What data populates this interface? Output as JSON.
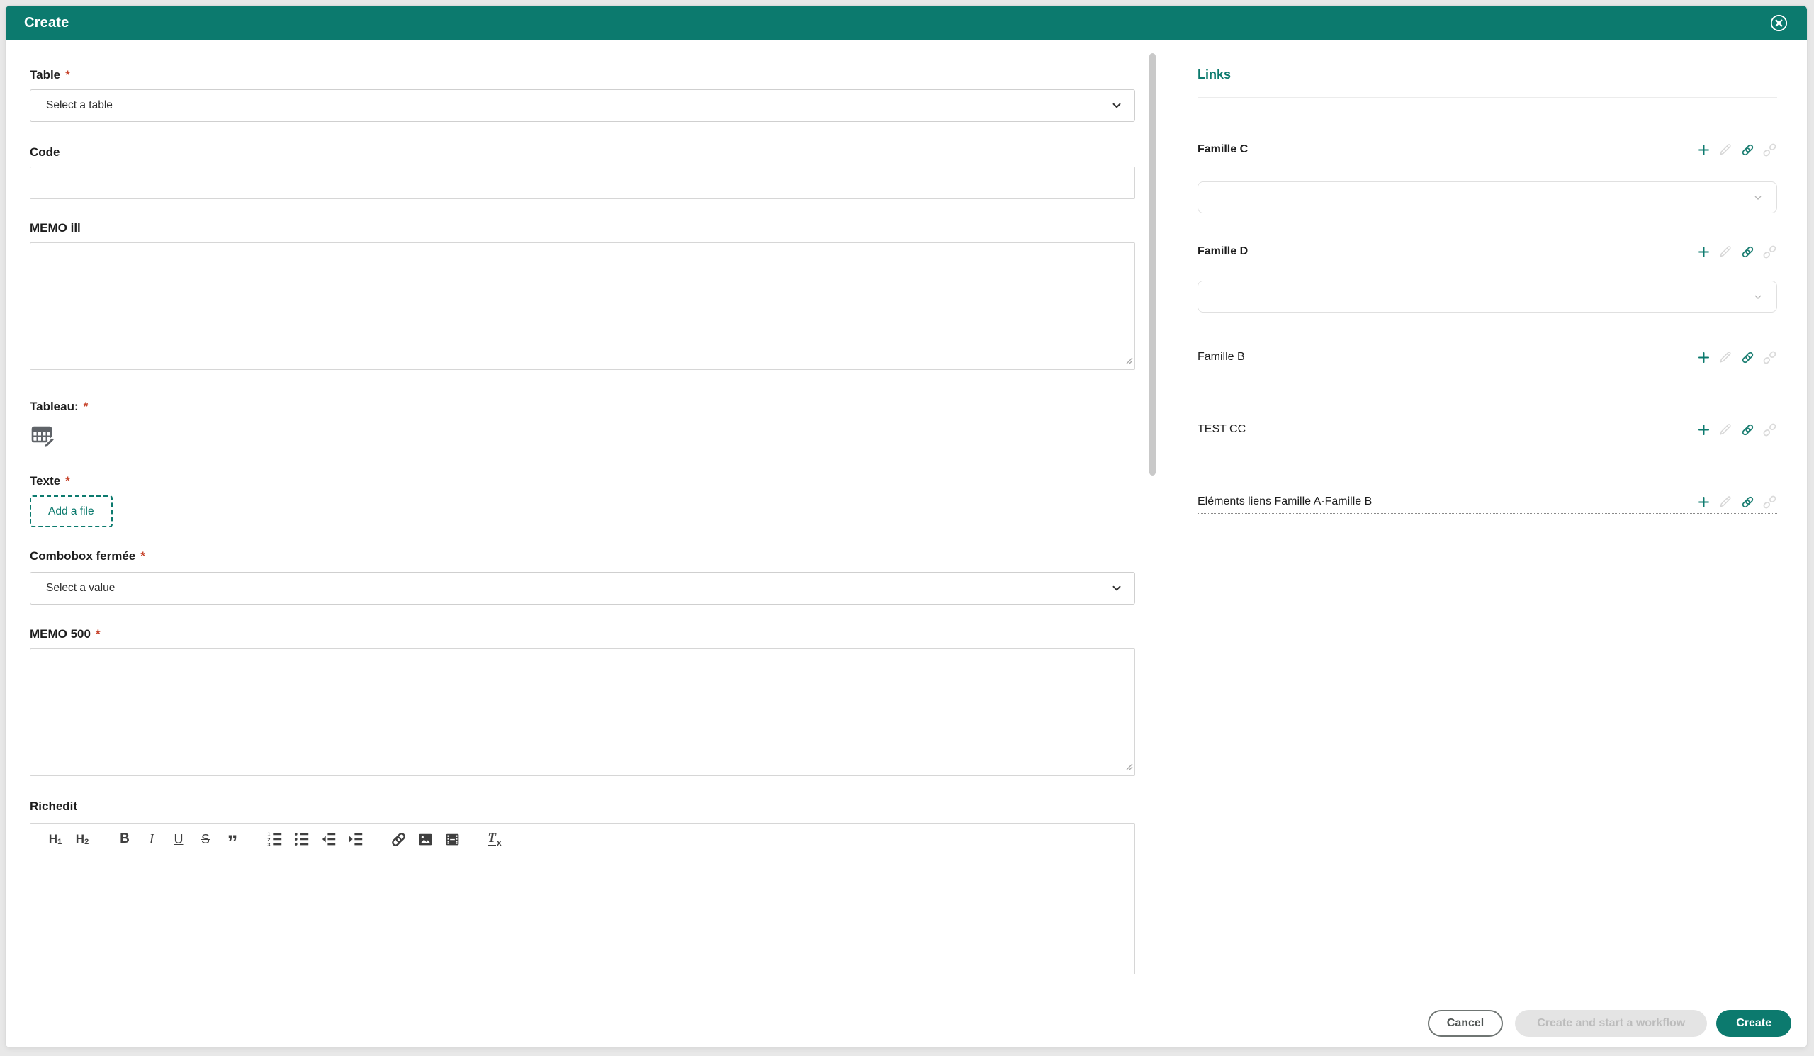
{
  "required_marker": "*",
  "colors": {
    "accent_teal": "#0c7a6e",
    "required_red": "#c7432b"
  },
  "header": {
    "title": "Create",
    "close_icon": "circled-x"
  },
  "form": {
    "fields": [
      {
        "label": "Table",
        "required": true,
        "type": "select",
        "value": "Select a table"
      },
      {
        "label": "Code",
        "required": false,
        "type": "text",
        "value": ""
      },
      {
        "label": "MEMO ill",
        "required": false,
        "type": "textarea",
        "value": ""
      },
      {
        "label": "Tableau:",
        "required": true,
        "type": "table-widget",
        "icon": "table-edit-icon"
      },
      {
        "label": "Texte",
        "required": true,
        "type": "file-upload",
        "button_label": "Add a file"
      },
      {
        "label": "Combobox fermée",
        "required": true,
        "type": "select",
        "value": "Select a value"
      },
      {
        "label": "MEMO 500",
        "required": true,
        "type": "textarea",
        "value": ""
      },
      {
        "label": "Richedit",
        "required": false,
        "type": "richtext",
        "value": ""
      }
    ],
    "richedit_toolbar": {
      "h1_base": "H",
      "h1_sub": "1",
      "h2_base": "H",
      "h2_sub": "2",
      "bold": "B",
      "italic": "I",
      "underline": "U",
      "strikethrough": "S",
      "blockquote": "”",
      "clear_base": "T",
      "clear_sub": "x",
      "icon_names": [
        "heading-1",
        "heading-2",
        "bold",
        "italic",
        "underline",
        "strikethrough",
        "blockquote",
        "ordered-list",
        "unordered-list",
        "decrease-indent",
        "increase-indent",
        "insert-link",
        "insert-image",
        "insert-media",
        "remove-format"
      ]
    }
  },
  "links": {
    "title": "Links",
    "action_icons": [
      "add-icon",
      "edit-icon",
      "link-icon",
      "unlink-icon"
    ],
    "groups": [
      {
        "label": "Famille C",
        "has_dropdown": true,
        "dropdown_value": ""
      },
      {
        "label": "Famille D",
        "has_dropdown": true,
        "dropdown_value": ""
      },
      {
        "label": "Famille B",
        "has_dropdown": false
      },
      {
        "label": "TEST CC",
        "has_dropdown": false
      },
      {
        "label": "Eléments liens Famille A-Famille B",
        "has_dropdown": false
      }
    ]
  },
  "footer": {
    "cancel_label": "Cancel",
    "workflow_label": "Create and start a workflow",
    "workflow_disabled": true,
    "create_label": "Create"
  }
}
